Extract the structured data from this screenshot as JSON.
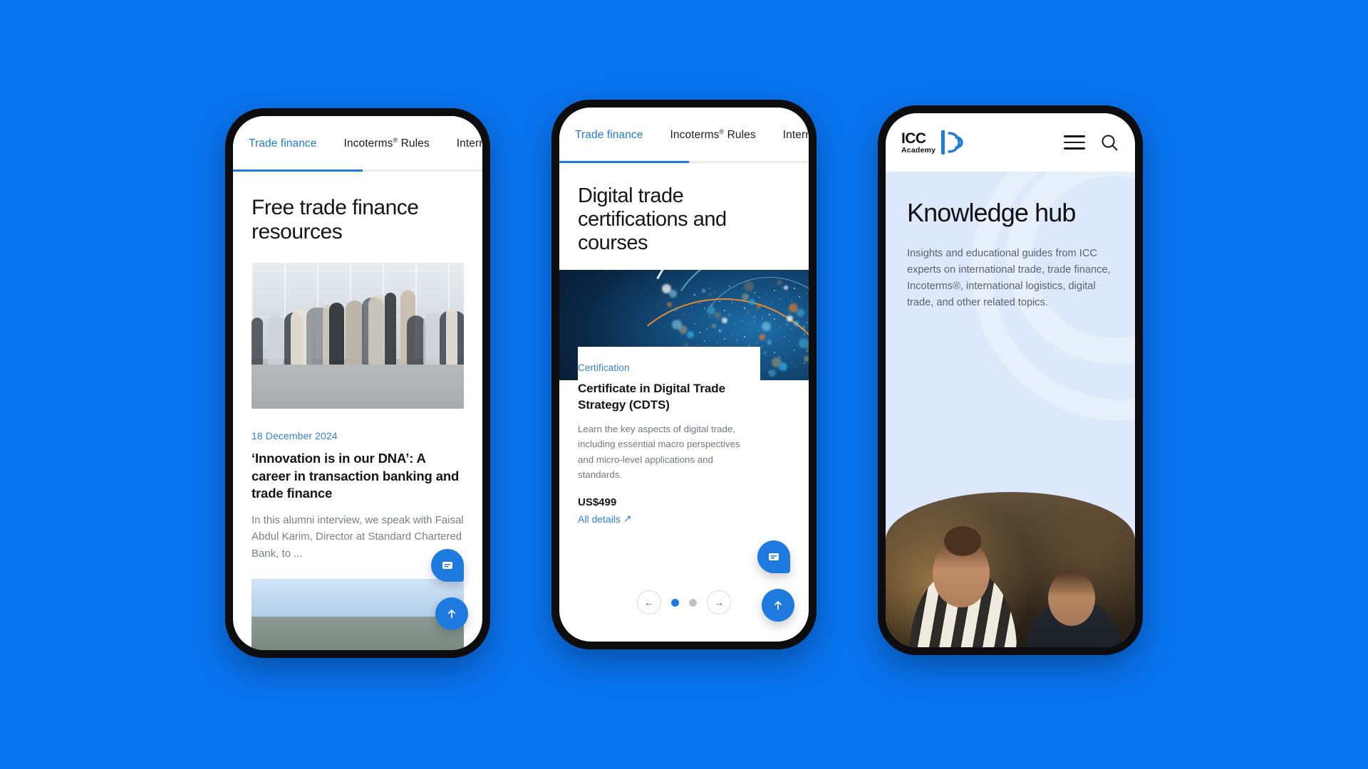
{
  "background_color": "#0a74f0",
  "brand": {
    "accent": "#1f7ae0",
    "link": "#2f7fe0",
    "text_dark": "#16161a",
    "text_muted": "#7b7f87"
  },
  "phones": [
    {
      "id": "phone-trade-finance-resources",
      "tabs": [
        {
          "label": "Trade finance",
          "active": true
        },
        {
          "label": "Incoterms",
          "sup": "®",
          "label_tail": " Rules",
          "active": false
        },
        {
          "label": "International t",
          "active": false
        }
      ],
      "page_title": "Free trade finance resources",
      "article": {
        "date": "18 December 2024",
        "title": "‘Innovation is in our DNA’: A career in transaction banking and trade finance",
        "summary": "In this alumni interview, we speak with Faisal Abdul Karim, Director at Standard Chartered Bank, to ..."
      },
      "fab_chat": "chat-icon",
      "fab_top": "arrow-up-icon"
    },
    {
      "id": "phone-digital-trade-certifications",
      "tabs": [
        {
          "label": "Trade finance",
          "active": true
        },
        {
          "label": "Incoterms",
          "sup": "®",
          "label_tail": " Rules",
          "active": false
        },
        {
          "label": "International t",
          "active": false
        }
      ],
      "page_title": "Digital trade certifications and courses",
      "course_card": {
        "tag": "Certification",
        "title": "Certificate in Digital Trade Strategy (CDTS)",
        "summary": "Learn the key aspects of digital trade, including essential macro perspectives and micro-level applications and standards.",
        "price": "US$499",
        "link": "All details",
        "link_icon": "↗"
      },
      "carousel": {
        "prev": "←",
        "next": "→",
        "dots": 2,
        "active_dot": 0
      },
      "fab_chat": "chat-icon",
      "fab_top": "arrow-up-icon"
    },
    {
      "id": "phone-knowledge-hub",
      "logo": {
        "name": "ICC",
        "sub": "Academy"
      },
      "header_icons": {
        "menu": "hamburger-menu-icon",
        "search": "search-icon"
      },
      "page_title": "Knowledge hub",
      "summary": "Insights and educational guides from ICC experts on international trade, trade finance, Incoterms®, international logistics, digital trade, and other related topics."
    }
  ]
}
